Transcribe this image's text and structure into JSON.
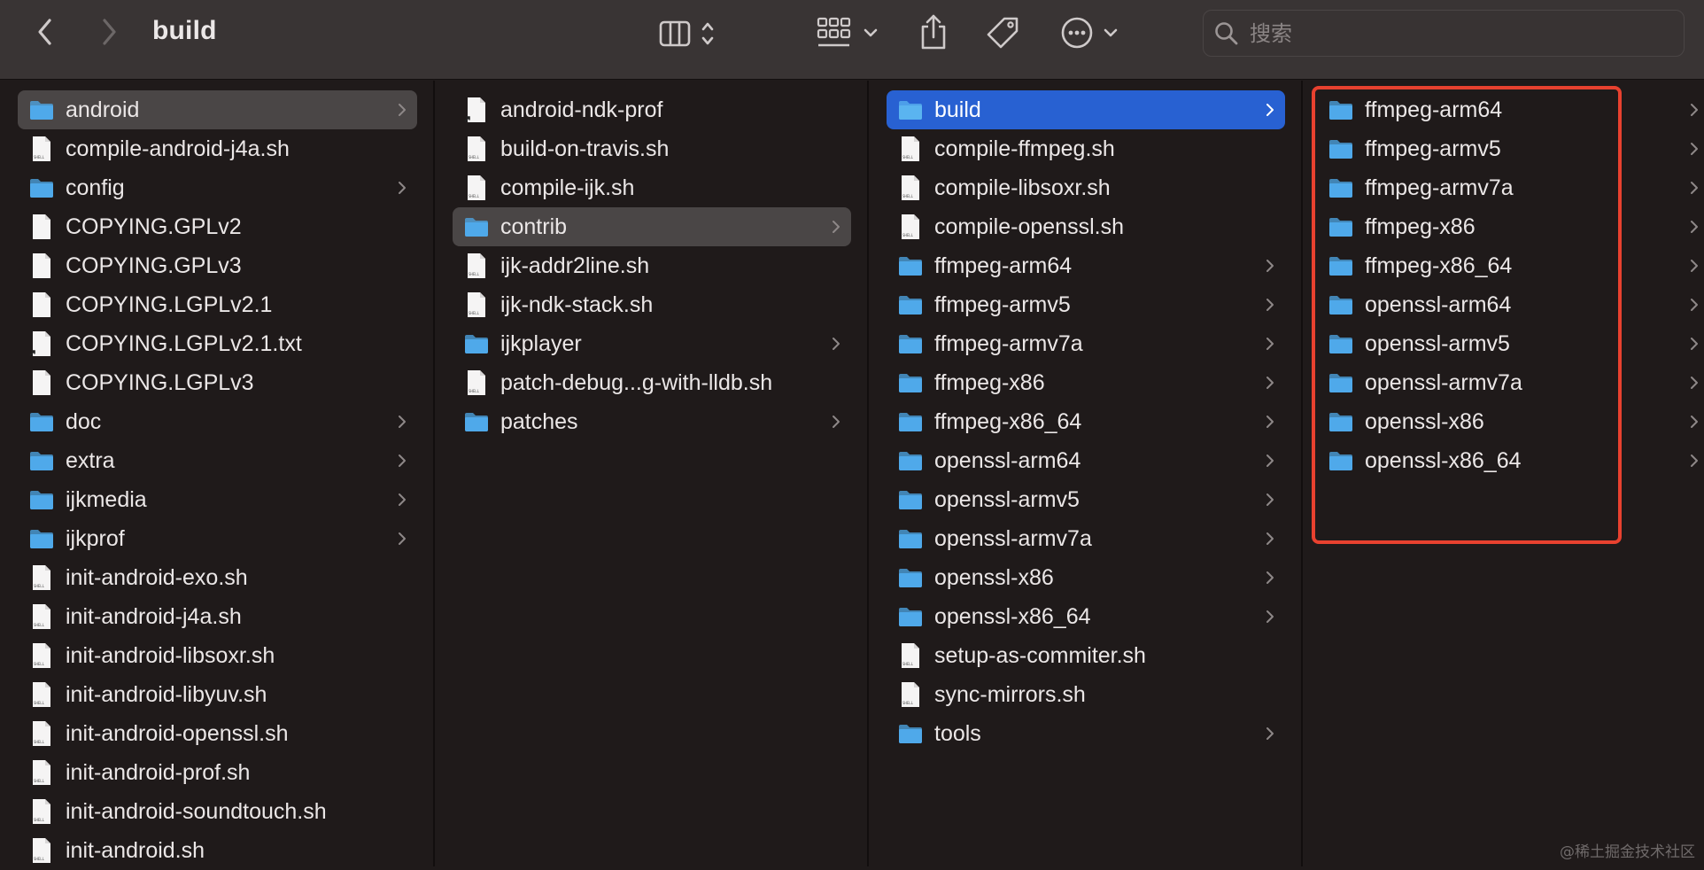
{
  "toolbar": {
    "title": "build",
    "search_placeholder": "搜索"
  },
  "columns": [
    {
      "items": [
        {
          "name": "android",
          "type": "folder",
          "chevron": true,
          "selected": "gray"
        },
        {
          "name": "compile-android-j4a.sh",
          "type": "shell"
        },
        {
          "name": "config",
          "type": "folder",
          "chevron": true
        },
        {
          "name": "COPYING.GPLv2",
          "type": "doc"
        },
        {
          "name": "COPYING.GPLv3",
          "type": "doc"
        },
        {
          "name": "COPYING.LGPLv2.1",
          "type": "doc"
        },
        {
          "name": "COPYING.LGPLv2.1.txt",
          "type": "alias"
        },
        {
          "name": "COPYING.LGPLv3",
          "type": "doc"
        },
        {
          "name": "doc",
          "type": "folder",
          "chevron": true
        },
        {
          "name": "extra",
          "type": "folder",
          "chevron": true
        },
        {
          "name": "ijkmedia",
          "type": "folder",
          "chevron": true
        },
        {
          "name": "ijkprof",
          "type": "folder",
          "chevron": true
        },
        {
          "name": "init-android-exo.sh",
          "type": "shell"
        },
        {
          "name": "init-android-j4a.sh",
          "type": "shell"
        },
        {
          "name": "init-android-libsoxr.sh",
          "type": "shell"
        },
        {
          "name": "init-android-libyuv.sh",
          "type": "shell"
        },
        {
          "name": "init-android-openssl.sh",
          "type": "shell"
        },
        {
          "name": "init-android-prof.sh",
          "type": "shell"
        },
        {
          "name": "init-android-soundtouch.sh",
          "type": "shell"
        },
        {
          "name": "init-android.sh",
          "type": "shell"
        }
      ]
    },
    {
      "items": [
        {
          "name": "android-ndk-prof",
          "type": "alias"
        },
        {
          "name": "build-on-travis.sh",
          "type": "shell"
        },
        {
          "name": "compile-ijk.sh",
          "type": "shell"
        },
        {
          "name": "contrib",
          "type": "folder",
          "chevron": true,
          "selected": "gray"
        },
        {
          "name": "ijk-addr2line.sh",
          "type": "shell"
        },
        {
          "name": "ijk-ndk-stack.sh",
          "type": "shell"
        },
        {
          "name": "ijkplayer",
          "type": "folder",
          "chevron": true
        },
        {
          "name": "patch-debug...g-with-lldb.sh",
          "type": "shell"
        },
        {
          "name": "patches",
          "type": "folder",
          "chevron": true
        }
      ]
    },
    {
      "items": [
        {
          "name": "build",
          "type": "folder",
          "chevron": true,
          "selected": "blue"
        },
        {
          "name": "compile-ffmpeg.sh",
          "type": "shell"
        },
        {
          "name": "compile-libsoxr.sh",
          "type": "shell"
        },
        {
          "name": "compile-openssl.sh",
          "type": "shell"
        },
        {
          "name": "ffmpeg-arm64",
          "type": "folder",
          "chevron": true
        },
        {
          "name": "ffmpeg-armv5",
          "type": "folder",
          "chevron": true
        },
        {
          "name": "ffmpeg-armv7a",
          "type": "folder",
          "chevron": true
        },
        {
          "name": "ffmpeg-x86",
          "type": "folder",
          "chevron": true
        },
        {
          "name": "ffmpeg-x86_64",
          "type": "folder",
          "chevron": true
        },
        {
          "name": "openssl-arm64",
          "type": "folder",
          "chevron": true
        },
        {
          "name": "openssl-armv5",
          "type": "folder",
          "chevron": true
        },
        {
          "name": "openssl-armv7a",
          "type": "folder",
          "chevron": true
        },
        {
          "name": "openssl-x86",
          "type": "folder",
          "chevron": true
        },
        {
          "name": "openssl-x86_64",
          "type": "folder",
          "chevron": true
        },
        {
          "name": "setup-as-commiter.sh",
          "type": "shell"
        },
        {
          "name": "sync-mirrors.sh",
          "type": "shell"
        },
        {
          "name": "tools",
          "type": "folder",
          "chevron": true
        }
      ]
    },
    {
      "items": [
        {
          "name": "ffmpeg-arm64",
          "type": "folder",
          "chevron": true
        },
        {
          "name": "ffmpeg-armv5",
          "type": "folder",
          "chevron": true
        },
        {
          "name": "ffmpeg-armv7a",
          "type": "folder",
          "chevron": true
        },
        {
          "name": "ffmpeg-x86",
          "type": "folder",
          "chevron": true
        },
        {
          "name": "ffmpeg-x86_64",
          "type": "folder",
          "chevron": true
        },
        {
          "name": "openssl-arm64",
          "type": "folder",
          "chevron": true
        },
        {
          "name": "openssl-armv5",
          "type": "folder",
          "chevron": true
        },
        {
          "name": "openssl-armv7a",
          "type": "folder",
          "chevron": true
        },
        {
          "name": "openssl-x86",
          "type": "folder",
          "chevron": true
        },
        {
          "name": "openssl-x86_64",
          "type": "folder",
          "chevron": true
        }
      ]
    }
  ],
  "watermark": "@稀土掘金技术社区",
  "colors": {
    "folder": "#4fa9ea",
    "selection_blue": "#2861d2",
    "selection_gray": "#4a4646",
    "highlight_box": "#e8412f"
  }
}
